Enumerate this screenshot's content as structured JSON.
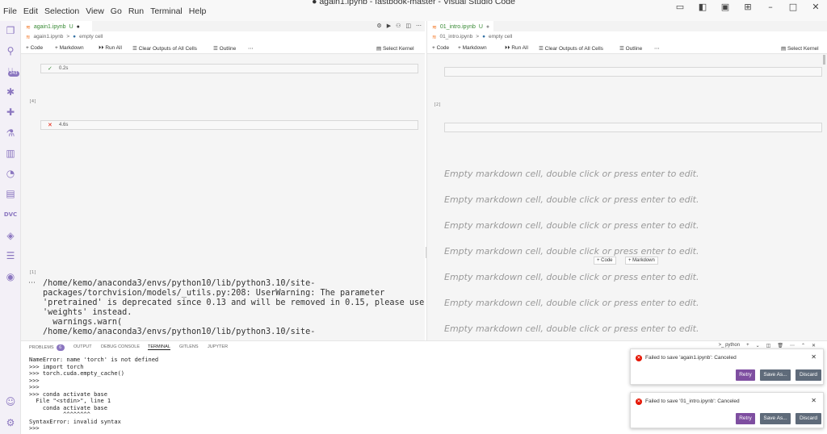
{
  "window": {
    "title": "● again1.ipynb - fastbook-master - Visual Studio Code"
  },
  "menu": [
    "File",
    "Edit",
    "Selection",
    "View",
    "Go",
    "Run",
    "Terminal",
    "Help"
  ],
  "activity_badge": "243",
  "left_editor": {
    "tab_label": "again1.ipynb",
    "tab_status": "U",
    "breadcrumb": [
      "again1.ipynb",
      ">",
      "empty cell"
    ],
    "toolbar": {
      "code": "Code",
      "markdown": "Markdown",
      "run_all": "Run All",
      "clear_outputs": "Clear Outputs of All Cells",
      "outline": "Outline",
      "select_kernel": "Select Kernel"
    },
    "cells": [
      {
        "status": "✓",
        "time": "0.2s"
      },
      {
        "status": "✕",
        "time": "4.6s"
      }
    ],
    "exec_counts": [
      "[4]",
      "[1]"
    ],
    "output_lines": [
      "/home/kemo/anaconda3/envs/python10/lib/python3.10/site-",
      "packages/torchvision/models/_utils.py:208: UserWarning: The parameter",
      "'pretrained' is deprecated since 0.13 and will be removed in 0.15, please use",
      "'weights' instead.",
      "  warnings.warn(",
      "/home/kemo/anaconda3/envs/python10/lib/python3.10/site-"
    ]
  },
  "right_editor": {
    "tab_label": "01_intro.ipynb",
    "tab_status": "U",
    "breadcrumb": [
      "01_intro.ipynb",
      ">",
      "empty cell"
    ],
    "toolbar": {
      "code": "Code",
      "markdown": "Markdown",
      "run_all": "Run All",
      "clear_outputs": "Clear Outputs of All Cells",
      "outline": "Outline",
      "select_kernel": "Select Kernel"
    },
    "exec_count": "[2]",
    "markdown_placeholder": "Empty markdown cell, double click or press enter to edit.",
    "add_code": "Code",
    "add_markdown": "Markdown"
  },
  "panel": {
    "tabs": [
      "PROBLEMS",
      "OUTPUT",
      "DEBUG CONSOLE",
      "TERMINAL",
      "GITLENS",
      "JUPYTER"
    ],
    "problems_count": "6",
    "terminal_name": "python",
    "terminal_lines": [
      "NameError: name 'torch' is not defined",
      ">>> import torch",
      ">>> torch.cuda.empty_cache()",
      ">>>",
      ">>>",
      ">>> conda activate base",
      "  File \"<stdin>\", line 1",
      "    conda activate base",
      "          ^^^^^^^^",
      "SyntaxError: invalid syntax",
      ">>> "
    ]
  },
  "notifications": [
    {
      "message": "Failed to save 'again1.ipynb': Canceled",
      "retry": "Retry",
      "save_as": "Save As...",
      "discard": "Discard"
    },
    {
      "message": "Failed to save '01_intro.ipynb': Canceled",
      "retry": "Retry",
      "save_as": "Save As...",
      "discard": "Discard"
    }
  ],
  "colors": {
    "accent": "#8b76c0",
    "error": "#e51400",
    "retry_button": "#7e4ea0",
    "secondary_button": "#5f6b7a",
    "modified_tab": "#388a34"
  }
}
